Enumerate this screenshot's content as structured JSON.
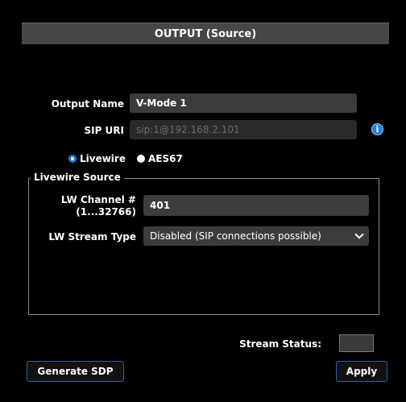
{
  "header": {
    "title": "OUTPUT (Source)"
  },
  "form": {
    "output_name_label": "Output Name",
    "output_name_value": "V-Mode 1",
    "sip_uri_label": "SIP URI",
    "sip_uri_value": "sip:1@192.168.2.101"
  },
  "source_type": {
    "options": [
      "Livewire",
      "AES67"
    ],
    "selected": "Livewire"
  },
  "livewire_source": {
    "legend": "Livewire Source",
    "channel_label_line1": "LW Channel #",
    "channel_label_line2": "(1...32766)",
    "channel_value": "401",
    "stream_type_label": "LW Stream Type",
    "stream_type_value": "Disabled (SIP connections possible)"
  },
  "status": {
    "stream_status_label": "Stream Status:",
    "stream_status_value": ""
  },
  "buttons": {
    "generate_sdp": "Generate SDP",
    "apply": "Apply"
  },
  "icons": {
    "info": "info-icon",
    "dropdown": "chevron-down-icon"
  },
  "colors": {
    "accent": "#1e7fd8",
    "header_bg": "#474747",
    "field_bg": "#3c3c3c"
  }
}
